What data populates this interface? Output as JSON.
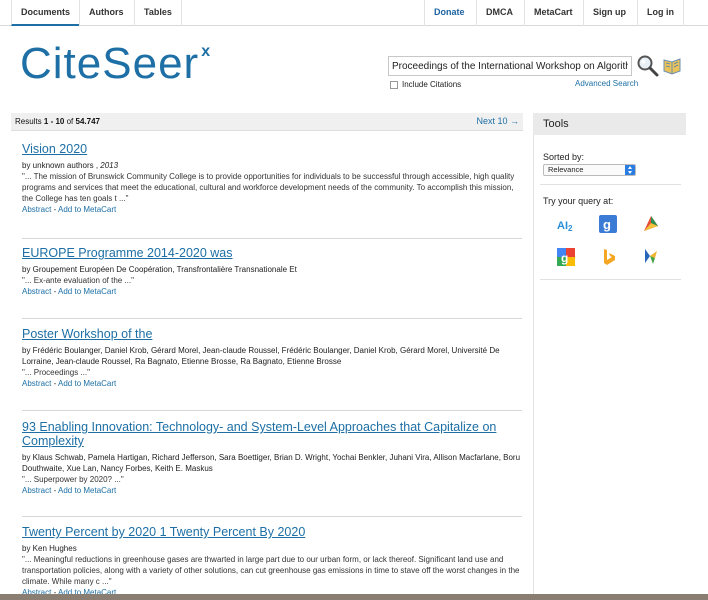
{
  "nav": {
    "documents": "Documents",
    "authors": "Authors",
    "tables": "Tables",
    "donate": "Donate",
    "dmca": "DMCA",
    "metacart": "MetaCart",
    "signup": "Sign up",
    "login": "Log in"
  },
  "logo": {
    "text": "CiteSeer",
    "sup": "x"
  },
  "search": {
    "query": "Proceedings of the International Workshop on Algorithmic",
    "include_citations": "Include Citations",
    "advanced": "Advanced Search"
  },
  "results": {
    "prefix": "Results ",
    "range": "1 - 10",
    "of": " of ",
    "total": "54.747",
    "next": "Next 10 →"
  },
  "items": [
    {
      "title": "Vision 2020",
      "authors": "by unknown authors , ",
      "year": "2013",
      "snippet": "\"... The mission of Brunswick Community College is to provide opportunities for individuals to be successful through accessible, high quality programs and services that meet the educational, cultural and workforce development needs of the community. To accomplish this mission, the College has ten goals t ...\"",
      "abstract": "Abstract",
      "sep": " - ",
      "add": "Add to MetaCart"
    },
    {
      "title": "EUROPE Programme 2014-2020 was",
      "authors": "by Groupement Européen De Coopération, Transfrontalière Transnationale Et",
      "snippet": "\"... Ex-ante evaluation of the ...\"",
      "abstract": "Abstract",
      "sep": " - ",
      "add": "Add to MetaCart"
    },
    {
      "title": "Poster Workshop of the",
      "authors": "by Frédéric Boulanger, Daniel Krob, Gérard Morel, Jean-claude Roussel, Frédéric Boulanger, Daniel Krob, Gérard Morel, Université De Lorraine, Jean-claude Roussel, Ra Bagnato, Etienne Brosse, Ra Bagnato, Etienne Brosse",
      "snippet": "\"... Proceedings ...\"",
      "abstract": "Abstract",
      "sep": " - ",
      "add": "Add to MetaCart"
    },
    {
      "title": "93 Enabling Innovation: Technology- and System-Level Approaches that Capitalize on Complexity",
      "authors": "by Klaus Schwab, Pamela Hartigan, Richard Jefferson, Sara Boettiger, Brian D. Wright, Yochai Benkler, Juhani Vira, Allison Macfarlane, Boru Douthwaite, Xue Lan, Nancy Forbes, Keith E. Maskus",
      "snippet": "\"... Superpower by 2020? ...\"",
      "abstract": "Abstract",
      "sep": " - ",
      "add": "Add to MetaCart"
    },
    {
      "title": "Twenty Percent by 2020 1 Twenty Percent By 2020",
      "authors": "by Ken Hughes",
      "snippet": "\"... Meaningful reductions in greenhouse gases are thwarted in large part due to our urban form, or lack thereof. Significant land use and transportation policies, along with a variety of other solutions, can cut greenhouse gas emissions in time to stave off the worst changes in the climate. While many c ...\"",
      "abstract": "Abstract",
      "sep": " - ",
      "add": "Add to MetaCart"
    }
  ],
  "tools": {
    "title": "Tools",
    "sorted_by": "Sorted by:",
    "sort_value": "Relevance",
    "try_query": "Try your query at:"
  },
  "colors": {
    "brand": "#1d6fa5",
    "link": "#1d6fa5"
  },
  "icons": [
    "search-icon",
    "rss-icon",
    "ai2-icon",
    "google-scholar-icon",
    "cyber-icon",
    "google-icon",
    "bing-icon",
    "dblp-icon"
  ]
}
